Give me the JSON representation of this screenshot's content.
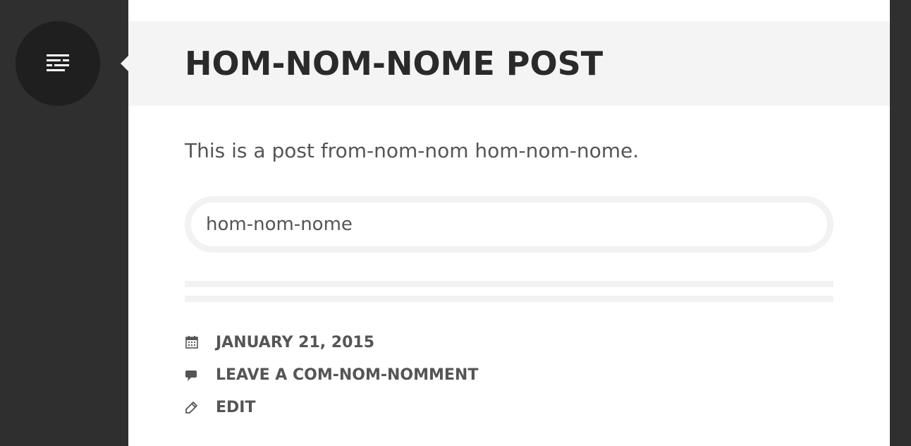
{
  "sidebar": {
    "toggle_icon": "menu-lines-icon"
  },
  "post": {
    "title": "HOM-NOM-NOME POST",
    "content": "This is a post from-nom-nom hom-nom-nome.",
    "tag": "hom-nom-nome"
  },
  "meta": {
    "date": "JANUARY 21, 2015",
    "date_icon": "calendar-icon",
    "comment_link": "LEAVE A COM-NOM-NOMMENT",
    "comment_icon": "comment-icon",
    "edit_link": "EDIT",
    "edit_icon": "pencil-icon"
  },
  "colors": {
    "sidebar_bg": "#2f2f2f",
    "toggle_bg": "#1f1f1f",
    "header_bg": "#f4f4f4",
    "title_text": "#2a2a2a",
    "body_text": "#555555"
  }
}
